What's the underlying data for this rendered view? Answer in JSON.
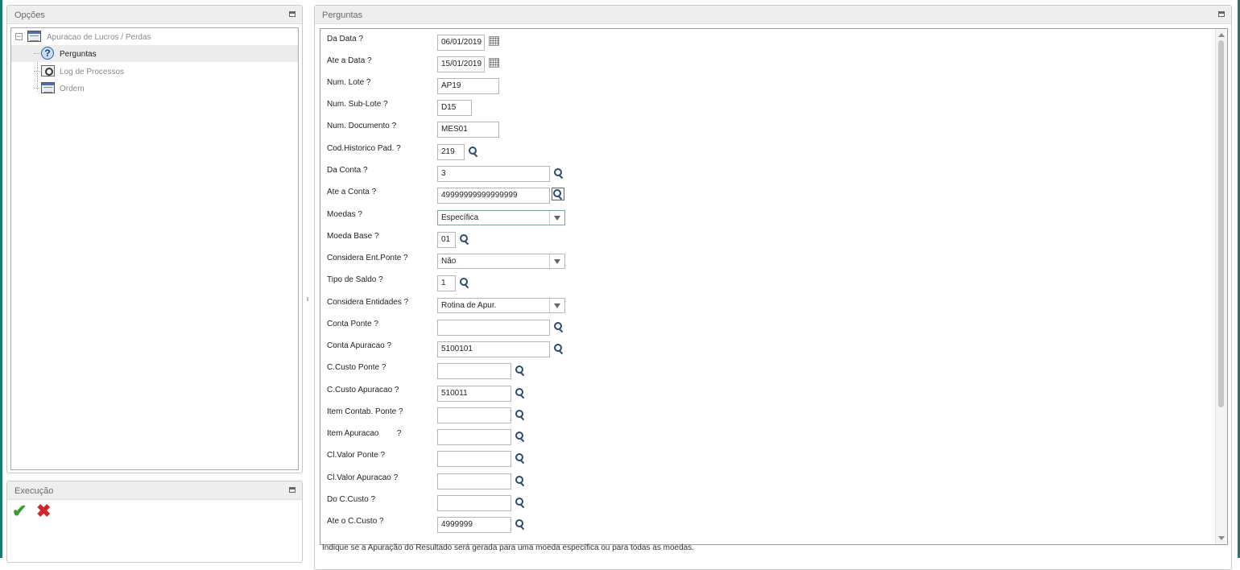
{
  "opcoes": {
    "title": "Opções",
    "tree": {
      "root": "Apuracao de Lucros / Perdas",
      "children": [
        "Perguntas",
        "Log de Processos",
        "Ordem"
      ],
      "selected": "Perguntas"
    }
  },
  "execucao": {
    "title": "Execução"
  },
  "perguntas": {
    "title": "Perguntas",
    "rows": [
      {
        "label": "Da Data ?",
        "value": "06/01/2019"
      },
      {
        "label": "Ate a Data ?",
        "value": "15/01/2019"
      },
      {
        "label": "Num. Lote ?",
        "value": "AP19"
      },
      {
        "label": "Num. Sub-Lote ?",
        "value": "D15"
      },
      {
        "label": "Num. Documento ?",
        "value": "MES01"
      },
      {
        "label": "Cod.Historico Pad. ?",
        "value": "219"
      },
      {
        "label": "Da Conta ?",
        "value": "3"
      },
      {
        "label": "Ate a Conta ?",
        "value": "49999999999999999"
      },
      {
        "label": "Moedas ?",
        "value": "Específica"
      },
      {
        "label": "Moeda Base ?",
        "value": "01"
      },
      {
        "label": "Considera Ent.Ponte ?",
        "value": "Não"
      },
      {
        "label": "Tipo de Saldo ?",
        "value": "1"
      },
      {
        "label": "Considera Entidades ?",
        "value": "Rotina de Apur."
      },
      {
        "label": "Conta Ponte ?",
        "value": ""
      },
      {
        "label": "Conta Apuracao ?",
        "value": "5100101"
      },
      {
        "label": "C.Custo Ponte ?",
        "value": ""
      },
      {
        "label": "C.Custo Apuracao ?",
        "value": "510011"
      },
      {
        "label": "Item Contab. Ponte ?",
        "value": ""
      },
      {
        "label": "Item Apuracao        ?",
        "value": ""
      },
      {
        "label": "Cl.Valor Ponte ?",
        "value": ""
      },
      {
        "label": "Cl.Valor Apuracao ?",
        "value": ""
      },
      {
        "label": "Do C.Custo ?",
        "value": ""
      },
      {
        "label": "Ate o C.Custo ?",
        "value": "4999999"
      }
    ]
  },
  "status_text": "Indique se a Apuração do Resultado será gerada para uma moeda específica ou para todas as moedas.",
  "colors": {
    "edge": "#1a7a70",
    "confirm": "#3b9a2f",
    "cancel": "#d0262a"
  }
}
